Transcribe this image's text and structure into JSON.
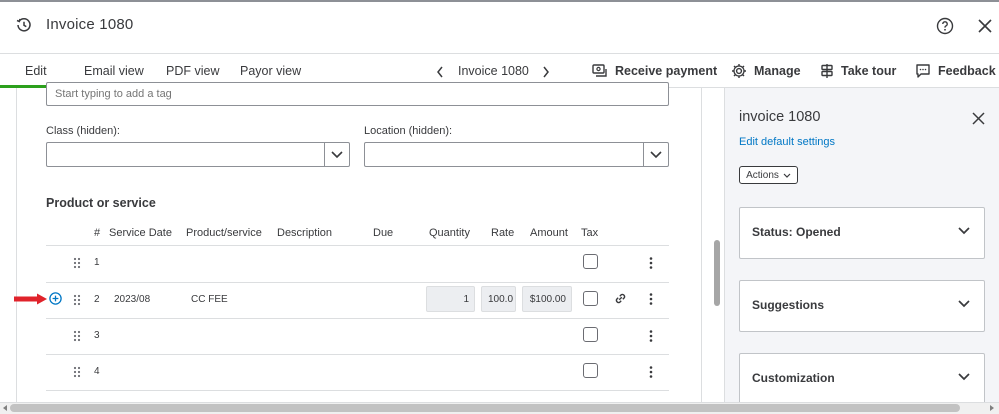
{
  "header": {
    "title": "Invoice 1080",
    "icons": [
      "history-icon",
      "help-icon",
      "close-icon"
    ]
  },
  "tabs": [
    {
      "label": "Edit",
      "active": true
    },
    {
      "label": "Email view",
      "active": false
    },
    {
      "label": "PDF view",
      "active": false
    },
    {
      "label": "Payor view",
      "active": false
    }
  ],
  "nav": {
    "label": "Invoice 1080"
  },
  "toolbar": {
    "receive_payment": "Receive payment",
    "manage": "Manage",
    "take_tour": "Take tour",
    "feedback": "Feedback"
  },
  "form": {
    "tag_placeholder": "Start typing to add a tag",
    "class_label": "Class (hidden):",
    "class_value": "",
    "location_label": "Location (hidden):",
    "location_value": "",
    "section_title": "Product or service"
  },
  "table": {
    "columns": [
      "#",
      "Service Date",
      "Product/service",
      "Description",
      "Due",
      "Quantity",
      "Rate",
      "Amount",
      "Tax"
    ],
    "rows": [
      {
        "num": "1",
        "service_date": "",
        "product": "",
        "description": "",
        "quantity": "",
        "rate": "",
        "amount": "",
        "tax": false
      },
      {
        "num": "2",
        "service_date": "2023/08",
        "product": "CC FEE",
        "description": "",
        "quantity": "1",
        "rate": "100.0",
        "amount": "$100.00",
        "tax": false
      },
      {
        "num": "3",
        "service_date": "",
        "product": "",
        "description": "",
        "quantity": "",
        "rate": "",
        "amount": "",
        "tax": false
      },
      {
        "num": "4",
        "service_date": "",
        "product": "",
        "description": "",
        "quantity": "",
        "rate": "",
        "amount": "",
        "tax": false
      }
    ]
  },
  "side_panel": {
    "title": "invoice 1080",
    "link": "Edit default settings",
    "actions_label": "Actions",
    "sections": [
      {
        "label": "Status: Opened"
      },
      {
        "label": "Suggestions"
      },
      {
        "label": "Customization"
      }
    ]
  },
  "colors": {
    "accent_green": "#2ca01c",
    "link_blue": "#0077c5",
    "annotation_red": "#e0232b",
    "text": "#393a3d"
  }
}
